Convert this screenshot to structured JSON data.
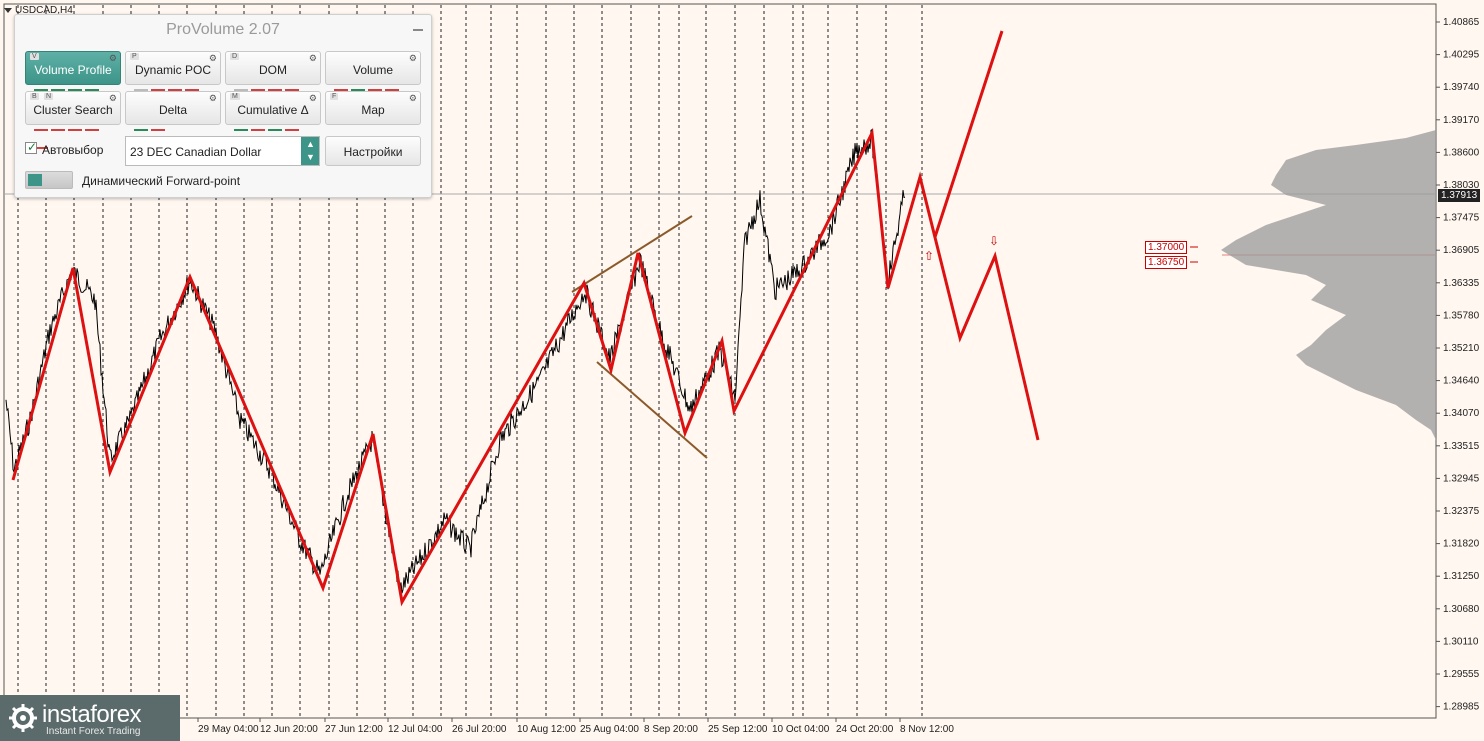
{
  "window": {
    "symbol": "USDCAD,H4"
  },
  "panel": {
    "title": "ProVolume 2.07",
    "buttons": [
      {
        "key": "V",
        "label": "Volume Profile",
        "active": true
      },
      {
        "key": "P",
        "label": "Dynamic POC",
        "active": false
      },
      {
        "key": "D",
        "label": "DOM",
        "active": false
      },
      {
        "key": "",
        "label": "Volume",
        "active": false
      },
      {
        "key": "B",
        "key2": "N",
        "label": "Cluster Search",
        "active": false
      },
      {
        "key": "",
        "label": "Delta",
        "active": false
      },
      {
        "key": "M",
        "label": "Cumulative Δ",
        "active": false
      },
      {
        "key": "F",
        "label": "Map",
        "active": false
      }
    ],
    "autoselect_label": "Автовыбор",
    "autoselect_checked": true,
    "instrument_value": "23 DEC Canadian Dollar",
    "settings_label": "Настройки",
    "forward_point_label": "Динамический Forward-point"
  },
  "price_axis": {
    "labels": [
      "1.40865",
      "1.40295",
      "1.39740",
      "1.39170",
      "1.38600",
      "1.38030",
      "1.37475",
      "1.36905",
      "1.36335",
      "1.35780",
      "1.35210",
      "1.34640",
      "1.34070",
      "1.33515",
      "1.32945",
      "1.32375",
      "1.31820",
      "1.31250",
      "1.30680",
      "1.30110",
      "1.29555",
      "1.28985"
    ],
    "current_price": "1.37913"
  },
  "time_axis": {
    "labels": [
      "29 May 04:00",
      "12 Jun 20:00",
      "27 Jun 12:00",
      "12 Jul 04:00",
      "26 Jul 20:00",
      "10 Aug 12:00",
      "25 Aug 04:00",
      "8 Sep 20:00",
      "25 Sep 12:00",
      "10 Oct 04:00",
      "24 Oct 20:00",
      "8 Nov 12:00"
    ]
  },
  "levels": [
    {
      "label": "1.37000",
      "color": "#cc0000"
    },
    {
      "label": "1.36750",
      "color": "#cc0000"
    }
  ],
  "colors": {
    "zigzag": "#dd1111",
    "channel": "#8b5a2b",
    "price": "#000000",
    "profile": "#9a9a9a",
    "accent": "#3d9488"
  },
  "logo": {
    "name": "instaforex",
    "tagline": "Instant Forex Trading"
  }
}
